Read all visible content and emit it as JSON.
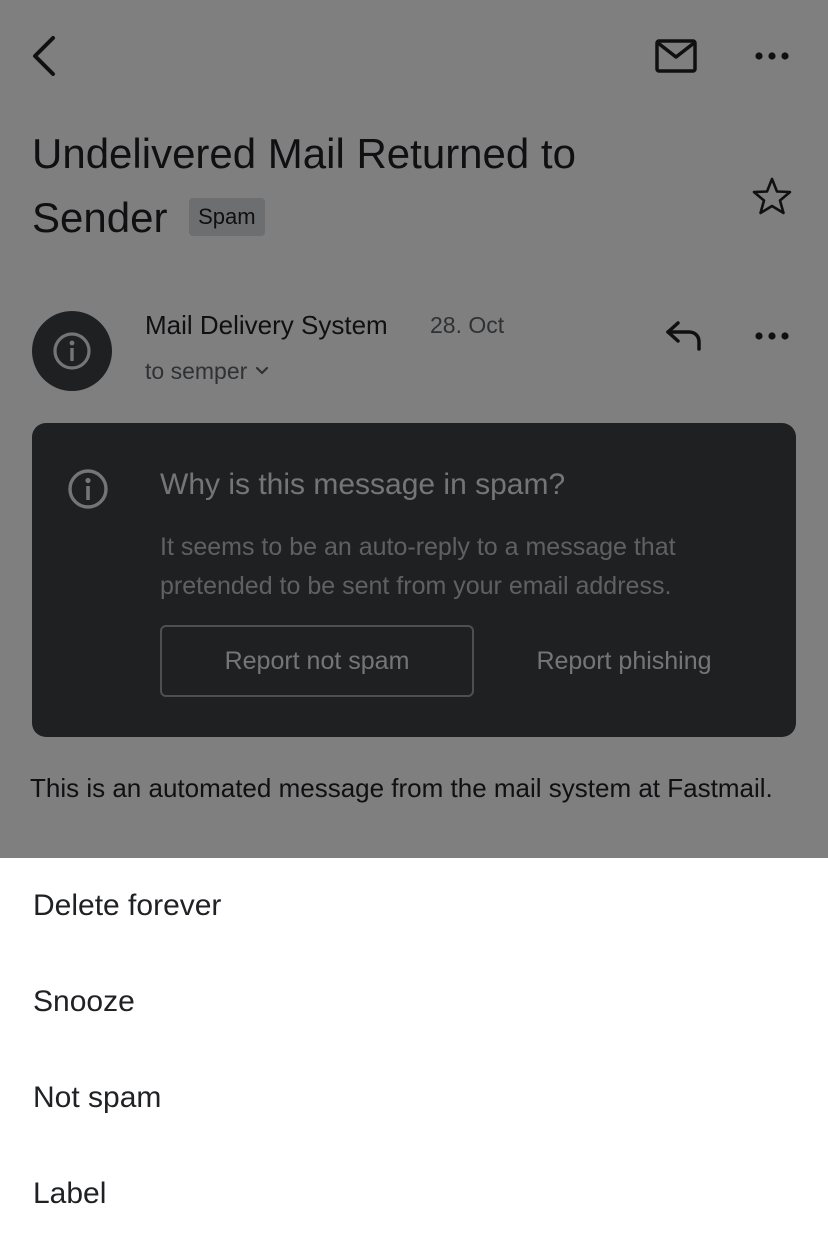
{
  "toolbar": {
    "back_icon": "chevron-left-icon",
    "mail_icon": "envelope-icon",
    "more_icon": "more-horizontal-icon"
  },
  "email": {
    "subject": "Undelivered Mail Returned to Sender",
    "label": "Spam",
    "starred": false,
    "sender_name": "Mail Delivery System",
    "date": "28. Oct",
    "recipient": "to semper",
    "body": "This is an automated message from the mail system at Fastmail."
  },
  "spam_card": {
    "title": "Why is this message in spam?",
    "text": "It seems to be an auto-reply to a message that pretended to be sent from your email address.",
    "report_not_spam_label": "Report not spam",
    "report_phishing_label": "Report phishing"
  },
  "action_sheet": {
    "items": [
      {
        "label": "Delete forever"
      },
      {
        "label": "Snooze"
      },
      {
        "label": "Not spam"
      },
      {
        "label": "Label"
      }
    ]
  },
  "colors": {
    "card_background": "#3c4043",
    "scrim": "rgba(0,0,0,0.5)",
    "text_primary": "#202124",
    "text_secondary": "#5f6368"
  }
}
